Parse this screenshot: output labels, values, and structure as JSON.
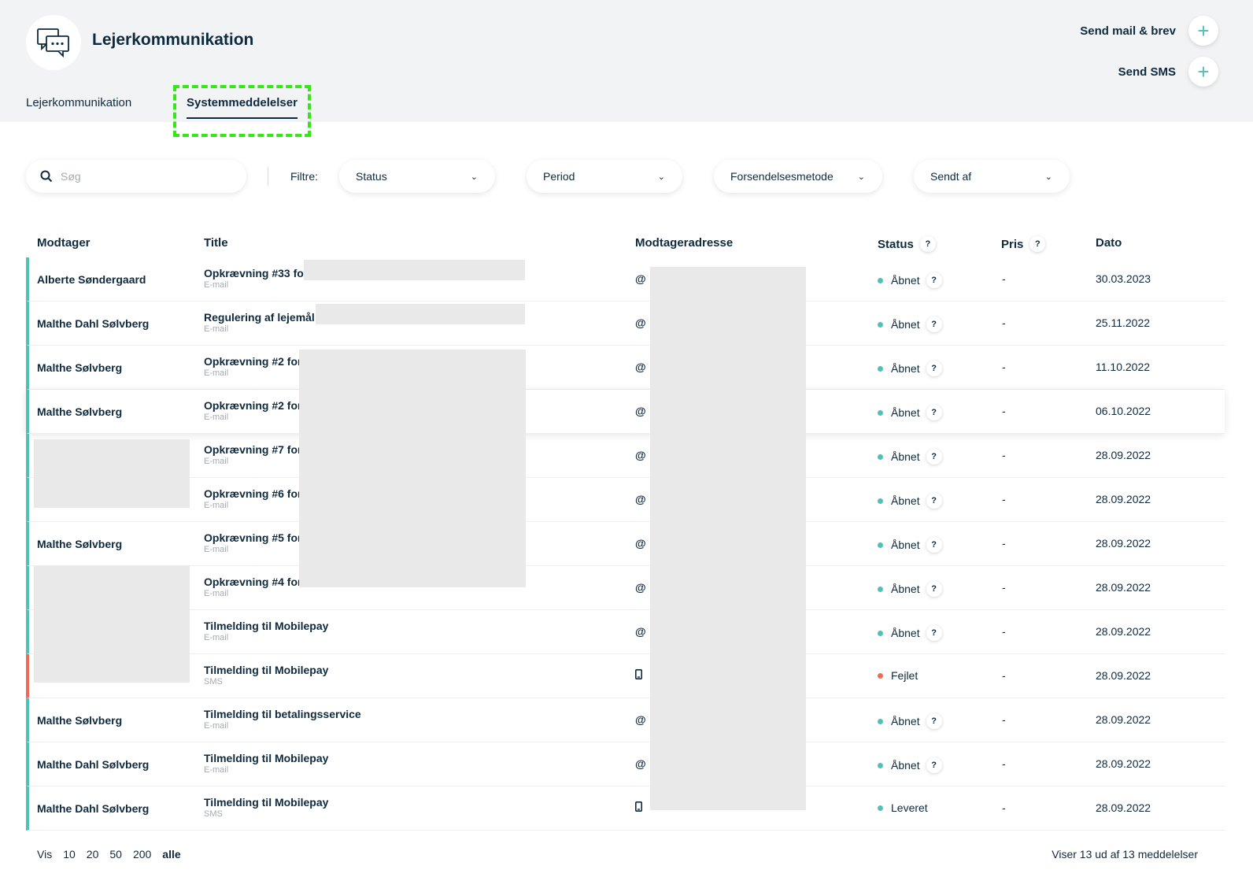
{
  "header": {
    "title": "Lejerkommunikation",
    "actions": [
      {
        "label": "Send mail & brev",
        "icon": "plus-icon"
      },
      {
        "label": "Send SMS",
        "icon": "plus-icon"
      }
    ]
  },
  "tabs": [
    {
      "label": "Lejerkommunikation",
      "active": false
    },
    {
      "label": "Systemmeddelelser",
      "active": true
    }
  ],
  "filters": {
    "search_placeholder": "Søg",
    "label": "Filtre:",
    "dropdowns": [
      "Status",
      "Period",
      "Forsendelsesmetode",
      "Sendt af"
    ]
  },
  "table": {
    "columns": [
      "Modtager",
      "Title",
      "Modtageradresse",
      "Status",
      "Pris",
      "Dato"
    ],
    "help_marker": "?",
    "rows": [
      {
        "recipient": "Alberte Søndergaard",
        "title": "Opkrævning #33 for",
        "method": "E-mail",
        "address_icon": "@",
        "status": "Åbnet",
        "status_color": "#4fc1b7",
        "price": "-",
        "date": "30.03.2023"
      },
      {
        "recipient": "Malthe Dahl Sølvberg",
        "title": "Regulering af lejemål -",
        "method": "E-mail",
        "address_icon": "@",
        "status": "Åbnet",
        "status_color": "#4fc1b7",
        "price": "-",
        "date": "25.11.2022"
      },
      {
        "recipient": "Malthe Sølvberg",
        "title": "Opkrævning #2 for",
        "method": "E-mail",
        "address_icon": "@",
        "status": "Åbnet",
        "status_color": "#4fc1b7",
        "price": "-",
        "date": "11.10.2022"
      },
      {
        "recipient": "Malthe Sølvberg",
        "title": "Opkrævning #2 for",
        "method": "E-mail",
        "address_icon": "@",
        "status": "Åbnet",
        "status_color": "#4fc1b7",
        "price": "-",
        "date": "06.10.2022"
      },
      {
        "recipient": "",
        "title": "Opkrævning #7 for",
        "method": "E-mail",
        "address_icon": "@",
        "status": "Åbnet",
        "status_color": "#4fc1b7",
        "price": "-",
        "date": "28.09.2022"
      },
      {
        "recipient": "",
        "title": "Opkrævning #6 for",
        "method": "E-mail",
        "address_icon": "@",
        "status": "Åbnet",
        "status_color": "#4fc1b7",
        "price": "-",
        "date": "28.09.2022"
      },
      {
        "recipient": "Malthe Sølvberg",
        "title": "Opkrævning #5 for",
        "method": "E-mail",
        "address_icon": "@",
        "status": "Åbnet",
        "status_color": "#4fc1b7",
        "price": "-",
        "date": "28.09.2022"
      },
      {
        "recipient": "",
        "title": "Opkrævning #4 for",
        "method": "E-mail",
        "address_icon": "@",
        "status": "Åbnet",
        "status_color": "#4fc1b7",
        "price": "-",
        "date": "28.09.2022"
      },
      {
        "recipient": "",
        "title": "Tilmelding til Mobilepay",
        "method": "E-mail",
        "address_icon": "@",
        "status": "Åbnet",
        "status_color": "#4fc1b7",
        "price": "-",
        "date": "28.09.2022"
      },
      {
        "recipient": "",
        "title": "Tilmelding til Mobilepay",
        "method": "SMS",
        "address_icon": "phone-icon",
        "status": "Fejlet",
        "status_color": "#ef6b57",
        "price": "-",
        "date": "28.09.2022"
      },
      {
        "recipient": "Malthe Sølvberg",
        "title": "Tilmelding til betalingsservice",
        "method": "E-mail",
        "address_icon": "@",
        "status": "Åbnet",
        "status_color": "#4fc1b7",
        "price": "-",
        "date": "28.09.2022"
      },
      {
        "recipient": "Malthe Dahl Sølvberg",
        "title": "Tilmelding til Mobilepay",
        "method": "E-mail",
        "address_icon": "@",
        "status": "Åbnet",
        "status_color": "#4fc1b7",
        "price": "-",
        "date": "28.09.2022"
      },
      {
        "recipient": "Malthe Dahl Sølvberg",
        "title": "Tilmelding til Mobilepay",
        "method": "SMS",
        "address_icon": "phone-icon",
        "status": "Leveret",
        "status_color": "#4fc1b7",
        "price": "-",
        "date": "28.09.2022"
      }
    ]
  },
  "footer": {
    "show_label": "Vis",
    "page_sizes": [
      "10",
      "20",
      "50",
      "200",
      "alle"
    ],
    "active_page_size": "alle",
    "summary": "Viser 13 ud af 13 meddelelser"
  },
  "colors": {
    "accent": "#4fc1b7",
    "error": "#ef6b57",
    "header_bg": "#f2f3f5",
    "text": "#0e2a3e"
  }
}
